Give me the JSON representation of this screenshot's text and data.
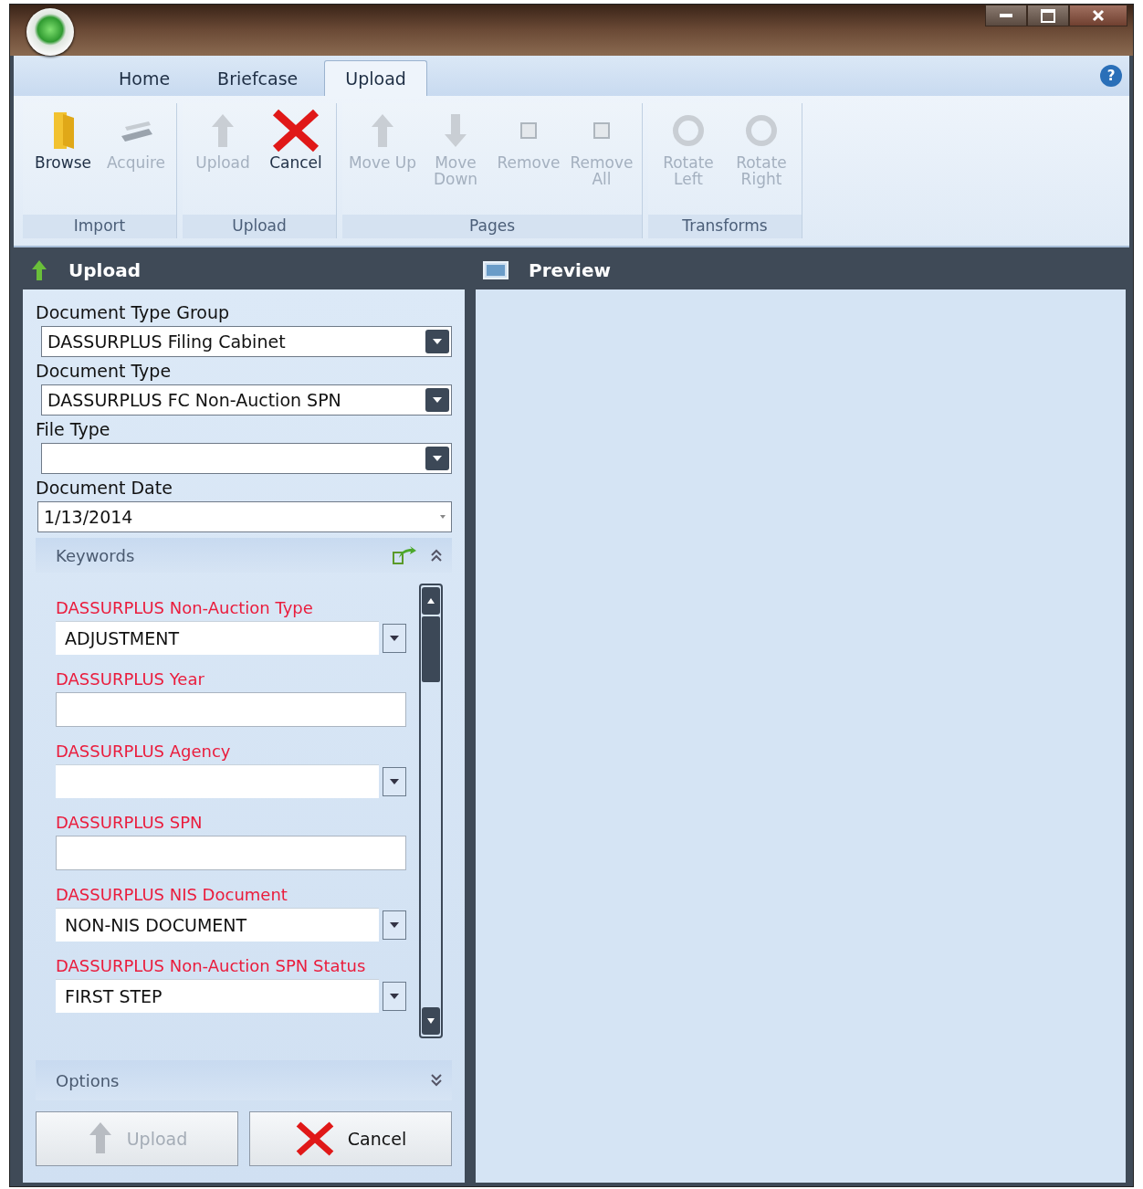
{
  "tabs": [
    {
      "label": "Home",
      "selected": false
    },
    {
      "label": "Briefcase",
      "selected": false
    },
    {
      "label": "Upload",
      "selected": true
    }
  ],
  "help": "?",
  "ribbon_groups": [
    {
      "label": "Import",
      "buttons": [
        {
          "label": "Browse",
          "disabled": false
        },
        {
          "label": "Acquire",
          "disabled": true
        }
      ]
    },
    {
      "label": "Upload",
      "buttons": [
        {
          "label": "Upload",
          "disabled": true
        },
        {
          "label": "Cancel",
          "disabled": false
        }
      ]
    },
    {
      "label": "Pages",
      "buttons": [
        {
          "label": "Move Up",
          "disabled": true
        },
        {
          "label": "Move Down",
          "disabled": true
        },
        {
          "label": "Remove",
          "disabled": true
        },
        {
          "label": "Remove All",
          "disabled": true
        }
      ]
    },
    {
      "label": "Transforms",
      "buttons": [
        {
          "label": "Rotate Left",
          "disabled": true
        },
        {
          "label": "Rotate Right",
          "disabled": true
        }
      ]
    }
  ],
  "upload_pane": {
    "title": "Upload",
    "fields": [
      {
        "label": "Document Type Group",
        "kind": "combo",
        "value": "DASSURPLUS Filing Cabinet"
      },
      {
        "label": "Document Type",
        "kind": "combo",
        "value": "DASSURPLUS FC Non-Auction SPN"
      },
      {
        "label": "File Type",
        "kind": "combo"
      },
      {
        "label": "Document Date",
        "kind": "date",
        "value": "1/13/2014"
      }
    ],
    "keywords_title": "Keywords",
    "keywords": [
      {
        "label": "DASSURPLUS Non-Auction Type",
        "kind": "combo",
        "value": "ADJUSTMENT"
      },
      {
        "label": "DASSURPLUS Year",
        "kind": "text"
      },
      {
        "label": "DASSURPLUS Agency",
        "kind": "combo"
      },
      {
        "label": "DASSURPLUS SPN",
        "kind": "text"
      },
      {
        "label": "DASSURPLUS NIS Document",
        "kind": "combo",
        "value": "NON-NIS DOCUMENT"
      },
      {
        "label": "DASSURPLUS Non-Auction SPN Status",
        "kind": "combo",
        "value": "FIRST STEP"
      }
    ],
    "options_title": "Options",
    "buttons": [
      {
        "label": "Upload",
        "disabled": true
      },
      {
        "label": "Cancel",
        "disabled": false
      }
    ]
  },
  "preview_pane": {
    "title": "Preview"
  }
}
